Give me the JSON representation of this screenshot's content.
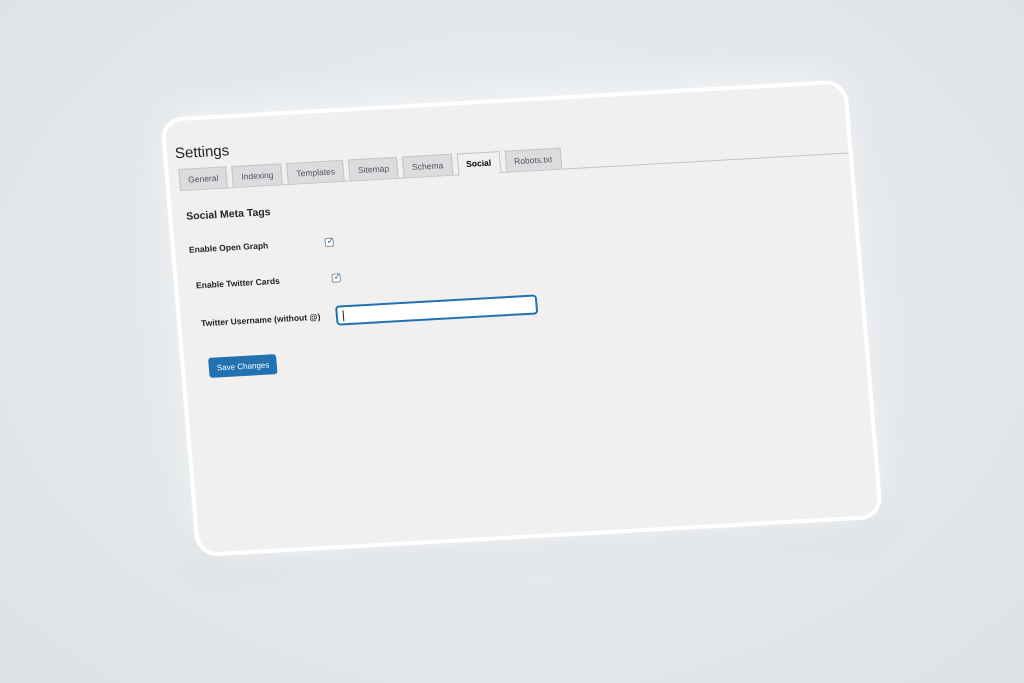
{
  "page": {
    "title": "Settings"
  },
  "tabs": [
    {
      "label": "General",
      "active": false
    },
    {
      "label": "Indexing",
      "active": false
    },
    {
      "label": "Templates",
      "active": false
    },
    {
      "label": "Sitemap",
      "active": false
    },
    {
      "label": "Schema",
      "active": false
    },
    {
      "label": "Social",
      "active": true
    },
    {
      "label": "Robots.txt",
      "active": false
    }
  ],
  "section": {
    "title": "Social Meta Tags"
  },
  "fields": {
    "open_graph": {
      "label": "Enable Open Graph",
      "checked": true
    },
    "twitter_cards": {
      "label": "Enable Twitter Cards",
      "checked": true
    },
    "twitter_username": {
      "label": "Twitter Username (without @)",
      "value": ""
    }
  },
  "actions": {
    "save_label": "Save Changes"
  },
  "colors": {
    "accent": "#2271b1",
    "card_bg": "#f0f0f1",
    "backdrop": "#e4e8eb"
  },
  "icons": {
    "checkbox_check": "checkmark-icon"
  }
}
